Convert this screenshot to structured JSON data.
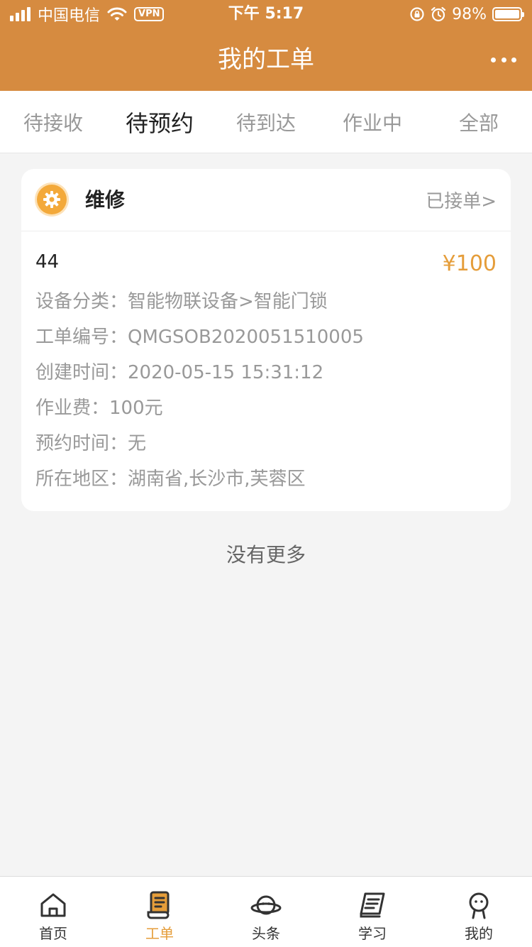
{
  "status_bar": {
    "carrier": "中国电信",
    "vpn": "VPN",
    "time": "下午 5:17",
    "battery": "98%"
  },
  "nav": {
    "title": "我的工单"
  },
  "tabs": [
    {
      "label": "待接收"
    },
    {
      "label": "待预约"
    },
    {
      "label": "待到达"
    },
    {
      "label": "作业中"
    },
    {
      "label": "全部"
    }
  ],
  "active_tab": "待预约",
  "order": {
    "category": "维修",
    "status": "已接单>",
    "name": "44",
    "price": "¥100",
    "rows": [
      {
        "text": "设备分类：智能物联设备>智能门锁"
      },
      {
        "text": "工单编号：QMGSOB2020051510005"
      },
      {
        "text": "创建时间：2020-05-15 15:31:12"
      },
      {
        "text": "作业费：100元"
      },
      {
        "text": "预约时间：无"
      },
      {
        "text": "所在地区：湖南省,长沙市,芙蓉区"
      }
    ]
  },
  "list_end": "没有更多",
  "tabbar": [
    {
      "label": "首页",
      "icon": "home-icon"
    },
    {
      "label": "工单",
      "icon": "work-order-icon"
    },
    {
      "label": "头条",
      "icon": "planet-icon"
    },
    {
      "label": "学习",
      "icon": "book-icon"
    },
    {
      "label": "我的",
      "icon": "profile-icon"
    }
  ],
  "colors": {
    "brand": "#d68b40",
    "accent": "#e59d3a"
  }
}
